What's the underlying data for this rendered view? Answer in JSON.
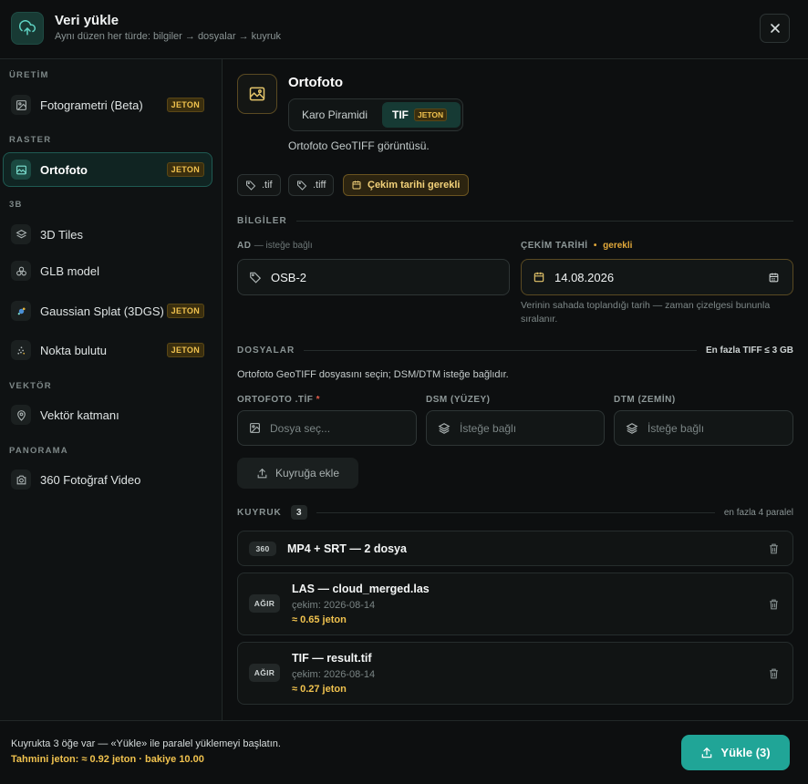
{
  "header": {
    "title": "Veri yükle",
    "subtitle": "Aynı düzen her türde: bilgiler → dosyalar → kuyruk"
  },
  "sidebar": {
    "sections": [
      {
        "title": "ÜRETİM",
        "items": [
          {
            "label": "Fotogrametri (Beta)",
            "badge": "JETON",
            "icon": "image-icon"
          }
        ]
      },
      {
        "title": "RASTER",
        "items": [
          {
            "label": "Ortofoto",
            "badge": "JETON",
            "icon": "orthophoto-icon",
            "active": true
          }
        ]
      },
      {
        "title": "3B",
        "items": [
          {
            "label": "3D Tiles",
            "badge": "",
            "icon": "tiles-icon"
          },
          {
            "label": "GLB model",
            "badge": "",
            "icon": "model-icon"
          },
          {
            "label": "Gaussian Splat (3DGS)",
            "badge": "JETON",
            "icon": "splat-icon"
          },
          {
            "label": "Nokta bulutu",
            "badge": "JETON",
            "icon": "point-cloud-icon"
          }
        ]
      },
      {
        "title": "VEKTÖR",
        "items": [
          {
            "label": "Vektör katmanı",
            "badge": "",
            "icon": "pin-icon"
          }
        ]
      },
      {
        "title": "PANORAMA",
        "items": [
          {
            "label": "360 Fotoğraf Video",
            "badge": "",
            "icon": "camera-icon"
          }
        ]
      }
    ]
  },
  "main": {
    "title": "Ortofoto",
    "segment": {
      "option1": "Karo Piramidi",
      "option2": "TIF",
      "option2_badge": "JETON"
    },
    "description": "Ortofoto GeoTIFF görüntüsü.",
    "chips": [
      ".tif",
      ".tiff",
      "Çekim tarihi gerekli"
    ],
    "info_section": "BİLGİLER",
    "name_label": "AD",
    "name_optional": "— isteğe bağlı",
    "name_value": "OSB-2",
    "date_label": "ÇEKİM TARİHİ",
    "date_required": "gerekli",
    "date_value": "14.08.2026",
    "date_help": "Verinin sahada toplandığı tarih — zaman çizelgesi bununla sıralanır.",
    "files_section": "DOSYALAR",
    "files_limit": "En fazla TIFF ≤ 3 GB",
    "files_desc": "Ortofoto GeoTIFF dosyasını seçin; DSM/DTM isteğe bağlıdır.",
    "file1_label": "ORTOFOTO .TİF",
    "file1_placeholder": "Dosya seç...",
    "file2_label": "DSM (YÜZEY)",
    "file2_placeholder": "İsteğe bağlı",
    "file3_label": "DTM (ZEMİN)",
    "file3_placeholder": "İsteğe bağlı",
    "queue_button": "Kuyruğa ekle",
    "queue_section": "KUYRUK",
    "queue_count": "3",
    "queue_limit": "en fazla 4 paralel",
    "queue": [
      {
        "badge": "360",
        "title": "MP4 + SRT — 2 dosya"
      },
      {
        "badge": "AĞIR",
        "title": "LAS — cloud_merged.las",
        "date": "çekim: 2026-08-14",
        "cost": "≈ 0.65 jeton"
      },
      {
        "badge": "AĞIR",
        "title": "TIF — result.tif",
        "date": "çekim: 2026-08-14",
        "cost": "≈ 0.27 jeton"
      }
    ]
  },
  "footer": {
    "info": "Kuyrukta 3 öğe var — «Yükle» ile paralel yüklemeyi başlatın.",
    "estimate": "Tahmini jeton: ≈ 0.92 jeton · bakiye 10.00",
    "upload_button": "Yükle (3)"
  },
  "colors": {
    "accent": "#20a597",
    "token": "#f0c24e",
    "background": "#0d0f10"
  }
}
